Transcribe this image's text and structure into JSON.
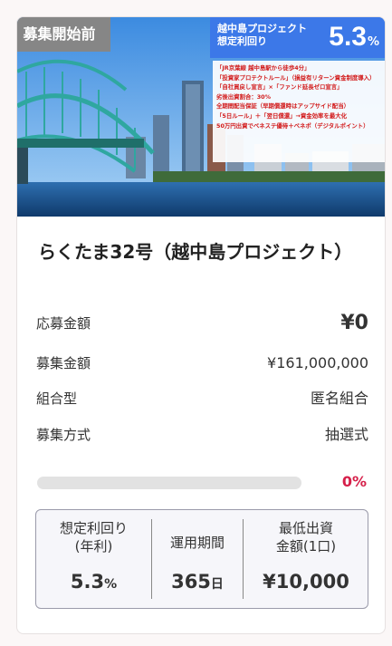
{
  "status_badge": "募集開始前",
  "yield_banner": {
    "line1": "越中島プロジェクト",
    "line2": "想定利回り",
    "value": "5.3",
    "unit": "%"
  },
  "promo_lines": [
    "「JR京葉線 越中島駅から徒歩4分」",
    "「投資家プロテクトルール」（損益有リターン資金制度導入）",
    "「自社買戻し宣言」×「ファンド延長ゼロ宣言」",
    "劣後出資割合：30%",
    "全期間配当保証（早期償還時はアップサイド配当）",
    "「5日ルール」＋「翌日償還」→資金効率を最大化",
    "50万円出資でベネステ優待＋ベネポ（デジタルポイント）"
  ],
  "title": "らくたま32号（越中島プロジェクト）",
  "details": {
    "applied_label": "応募金額",
    "applied_value": "¥0",
    "target_label": "募集金額",
    "target_value": "¥161,000,000",
    "type_label": "組合型",
    "type_value": "匿名組合",
    "method_label": "募集方式",
    "method_value": "抽選式"
  },
  "progress": {
    "percent": 0,
    "label": "0%"
  },
  "stats": {
    "yield_label_1": "想定利回り",
    "yield_label_2": "(年利)",
    "yield_value": "5.3",
    "yield_unit": "%",
    "period_label": "運用期間",
    "period_value": "365",
    "period_unit": "日",
    "min_label_1": "最低出資",
    "min_label_2": "金額(1口)",
    "min_value": "¥10,000"
  },
  "colors": {
    "accent": "#d6204a",
    "banner_blue": "#3c78e8",
    "badge_gray": "#868686"
  }
}
